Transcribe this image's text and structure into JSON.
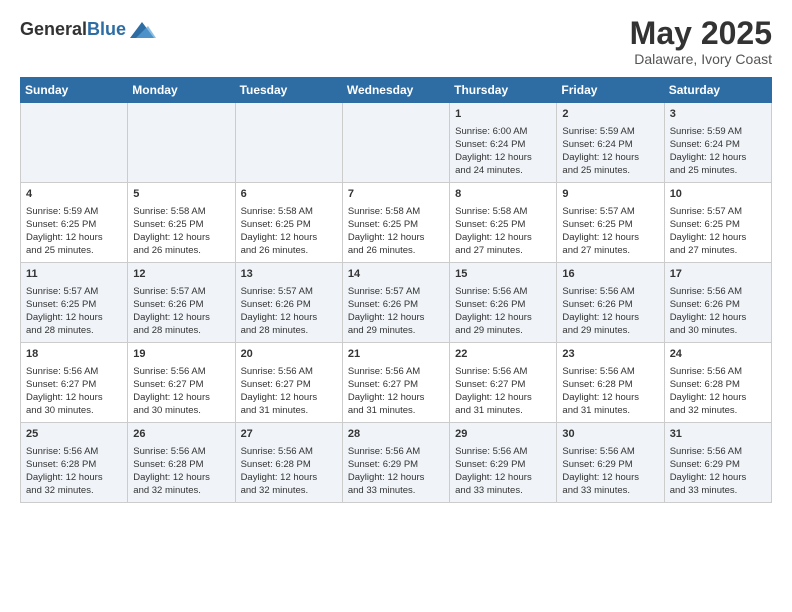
{
  "header": {
    "logo_line1": "General",
    "logo_line2": "Blue",
    "title": "May 2025",
    "subtitle": "Dalaware, Ivory Coast"
  },
  "days_of_week": [
    "Sunday",
    "Monday",
    "Tuesday",
    "Wednesday",
    "Thursday",
    "Friday",
    "Saturday"
  ],
  "weeks": [
    [
      {
        "day": "",
        "info": ""
      },
      {
        "day": "",
        "info": ""
      },
      {
        "day": "",
        "info": ""
      },
      {
        "day": "",
        "info": ""
      },
      {
        "day": "1",
        "info": "Sunrise: 6:00 AM\nSunset: 6:24 PM\nDaylight: 12 hours\nand 24 minutes."
      },
      {
        "day": "2",
        "info": "Sunrise: 5:59 AM\nSunset: 6:24 PM\nDaylight: 12 hours\nand 25 minutes."
      },
      {
        "day": "3",
        "info": "Sunrise: 5:59 AM\nSunset: 6:24 PM\nDaylight: 12 hours\nand 25 minutes."
      }
    ],
    [
      {
        "day": "4",
        "info": "Sunrise: 5:59 AM\nSunset: 6:25 PM\nDaylight: 12 hours\nand 25 minutes."
      },
      {
        "day": "5",
        "info": "Sunrise: 5:58 AM\nSunset: 6:25 PM\nDaylight: 12 hours\nand 26 minutes."
      },
      {
        "day": "6",
        "info": "Sunrise: 5:58 AM\nSunset: 6:25 PM\nDaylight: 12 hours\nand 26 minutes."
      },
      {
        "day": "7",
        "info": "Sunrise: 5:58 AM\nSunset: 6:25 PM\nDaylight: 12 hours\nand 26 minutes."
      },
      {
        "day": "8",
        "info": "Sunrise: 5:58 AM\nSunset: 6:25 PM\nDaylight: 12 hours\nand 27 minutes."
      },
      {
        "day": "9",
        "info": "Sunrise: 5:57 AM\nSunset: 6:25 PM\nDaylight: 12 hours\nand 27 minutes."
      },
      {
        "day": "10",
        "info": "Sunrise: 5:57 AM\nSunset: 6:25 PM\nDaylight: 12 hours\nand 27 minutes."
      }
    ],
    [
      {
        "day": "11",
        "info": "Sunrise: 5:57 AM\nSunset: 6:25 PM\nDaylight: 12 hours\nand 28 minutes."
      },
      {
        "day": "12",
        "info": "Sunrise: 5:57 AM\nSunset: 6:26 PM\nDaylight: 12 hours\nand 28 minutes."
      },
      {
        "day": "13",
        "info": "Sunrise: 5:57 AM\nSunset: 6:26 PM\nDaylight: 12 hours\nand 28 minutes."
      },
      {
        "day": "14",
        "info": "Sunrise: 5:57 AM\nSunset: 6:26 PM\nDaylight: 12 hours\nand 29 minutes."
      },
      {
        "day": "15",
        "info": "Sunrise: 5:56 AM\nSunset: 6:26 PM\nDaylight: 12 hours\nand 29 minutes."
      },
      {
        "day": "16",
        "info": "Sunrise: 5:56 AM\nSunset: 6:26 PM\nDaylight: 12 hours\nand 29 minutes."
      },
      {
        "day": "17",
        "info": "Sunrise: 5:56 AM\nSunset: 6:26 PM\nDaylight: 12 hours\nand 30 minutes."
      }
    ],
    [
      {
        "day": "18",
        "info": "Sunrise: 5:56 AM\nSunset: 6:27 PM\nDaylight: 12 hours\nand 30 minutes."
      },
      {
        "day": "19",
        "info": "Sunrise: 5:56 AM\nSunset: 6:27 PM\nDaylight: 12 hours\nand 30 minutes."
      },
      {
        "day": "20",
        "info": "Sunrise: 5:56 AM\nSunset: 6:27 PM\nDaylight: 12 hours\nand 31 minutes."
      },
      {
        "day": "21",
        "info": "Sunrise: 5:56 AM\nSunset: 6:27 PM\nDaylight: 12 hours\nand 31 minutes."
      },
      {
        "day": "22",
        "info": "Sunrise: 5:56 AM\nSunset: 6:27 PM\nDaylight: 12 hours\nand 31 minutes."
      },
      {
        "day": "23",
        "info": "Sunrise: 5:56 AM\nSunset: 6:28 PM\nDaylight: 12 hours\nand 31 minutes."
      },
      {
        "day": "24",
        "info": "Sunrise: 5:56 AM\nSunset: 6:28 PM\nDaylight: 12 hours\nand 32 minutes."
      }
    ],
    [
      {
        "day": "25",
        "info": "Sunrise: 5:56 AM\nSunset: 6:28 PM\nDaylight: 12 hours\nand 32 minutes."
      },
      {
        "day": "26",
        "info": "Sunrise: 5:56 AM\nSunset: 6:28 PM\nDaylight: 12 hours\nand 32 minutes."
      },
      {
        "day": "27",
        "info": "Sunrise: 5:56 AM\nSunset: 6:28 PM\nDaylight: 12 hours\nand 32 minutes."
      },
      {
        "day": "28",
        "info": "Sunrise: 5:56 AM\nSunset: 6:29 PM\nDaylight: 12 hours\nand 33 minutes."
      },
      {
        "day": "29",
        "info": "Sunrise: 5:56 AM\nSunset: 6:29 PM\nDaylight: 12 hours\nand 33 minutes."
      },
      {
        "day": "30",
        "info": "Sunrise: 5:56 AM\nSunset: 6:29 PM\nDaylight: 12 hours\nand 33 minutes."
      },
      {
        "day": "31",
        "info": "Sunrise: 5:56 AM\nSunset: 6:29 PM\nDaylight: 12 hours\nand 33 minutes."
      }
    ]
  ]
}
